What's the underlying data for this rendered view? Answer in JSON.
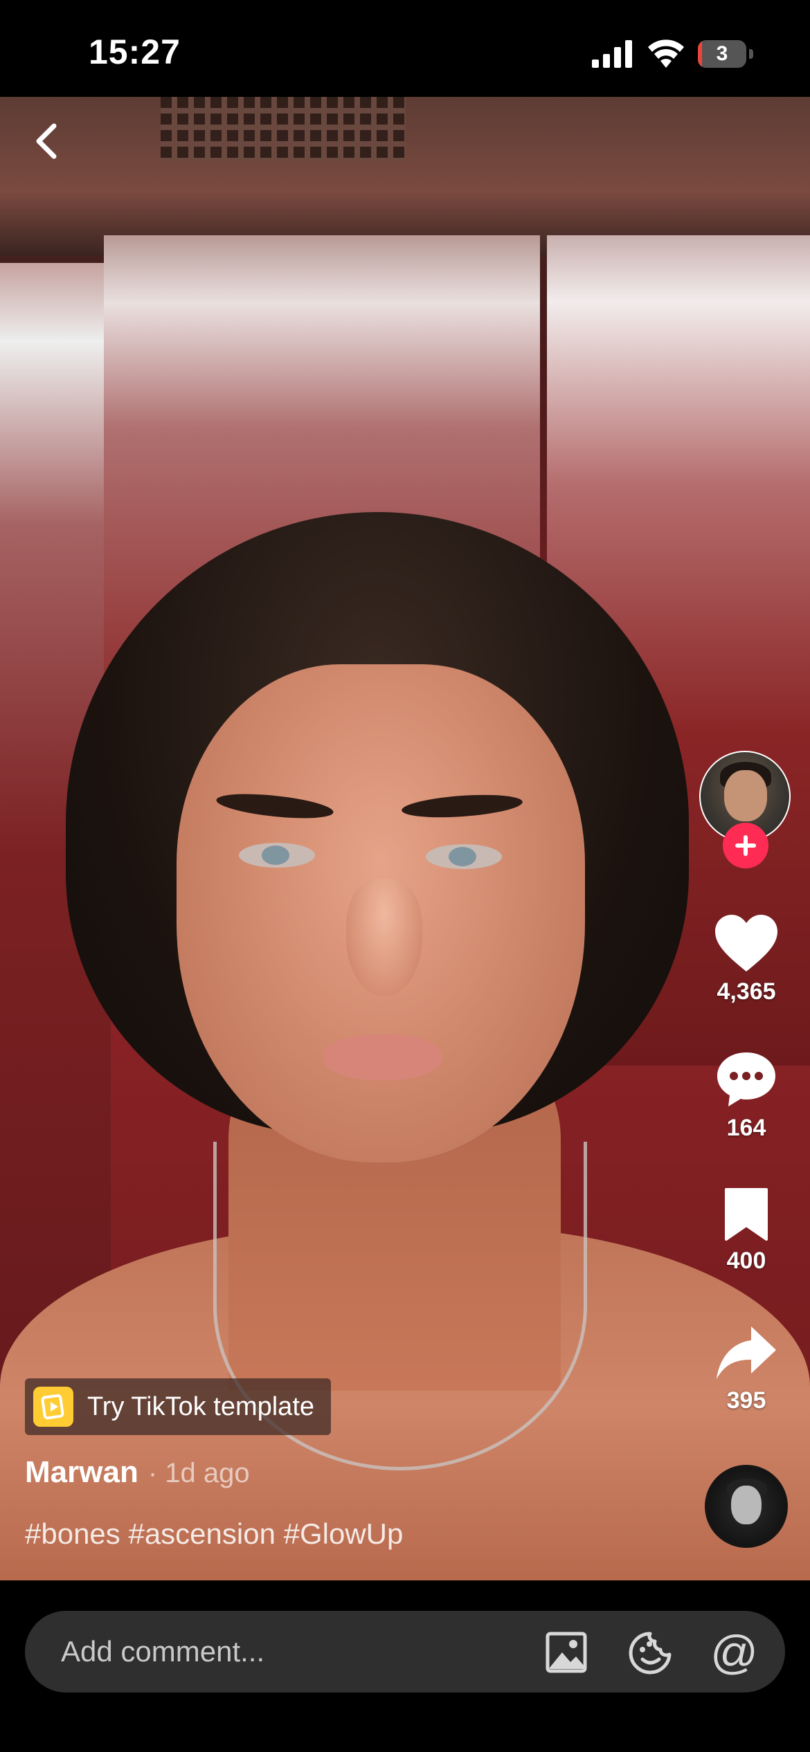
{
  "status_bar": {
    "time": "15:27",
    "battery_level": "3",
    "battery_fraction": 0.03
  },
  "video": {
    "author": "Marwan",
    "posted": "· 1d ago",
    "hashtags": "#bones #ascension #GlowUp",
    "template_label": "Try TikTok template"
  },
  "actions": {
    "likes": "4,365",
    "comments": "164",
    "saves": "400",
    "shares": "395"
  },
  "comment_bar": {
    "placeholder": "Add comment...",
    "at_symbol": "@"
  },
  "colors": {
    "accent": "#fe2c55",
    "template_icon": "#ffcc33",
    "battery_low": "#e8453c"
  }
}
